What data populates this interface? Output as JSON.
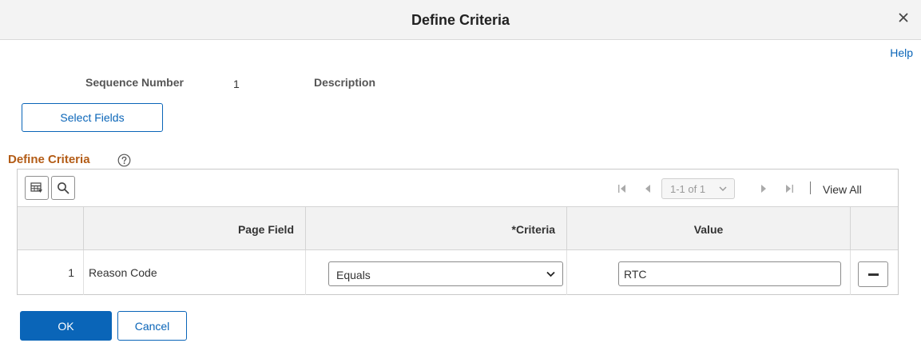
{
  "dialog": {
    "title": "Define Criteria",
    "close_icon": "close-icon",
    "help_label": "Help"
  },
  "header": {
    "sequence_label": "Sequence Number",
    "sequence_value": "1",
    "description_label": "Description",
    "select_fields_label": "Select Fields"
  },
  "section": {
    "title": "Define Criteria",
    "help_icon": "question-circle-icon"
  },
  "toolbar": {
    "personalize_icon": "grid-personalize-icon",
    "find_icon": "search-icon"
  },
  "pager": {
    "first_icon": "first-page-icon",
    "prev_icon": "previous-page-icon",
    "range": "1-1 of 1",
    "next_icon": "next-page-icon",
    "last_icon": "last-page-icon",
    "view_all": "View All"
  },
  "table": {
    "columns": [
      "",
      "Page Field",
      "*Criteria",
      "Value",
      ""
    ],
    "rows": [
      {
        "row_number": "1",
        "page_field": "Reason Code",
        "criteria": "Equals",
        "value": "RTC",
        "delete_icon": "minus-icon"
      }
    ]
  },
  "footer": {
    "ok_label": "OK",
    "cancel_label": "Cancel"
  },
  "colors": {
    "accent": "#0a65b8",
    "section_title": "#b35c16",
    "titlebar_bg": "#f3f3f3",
    "table_header_bg": "#f2f2f2"
  }
}
